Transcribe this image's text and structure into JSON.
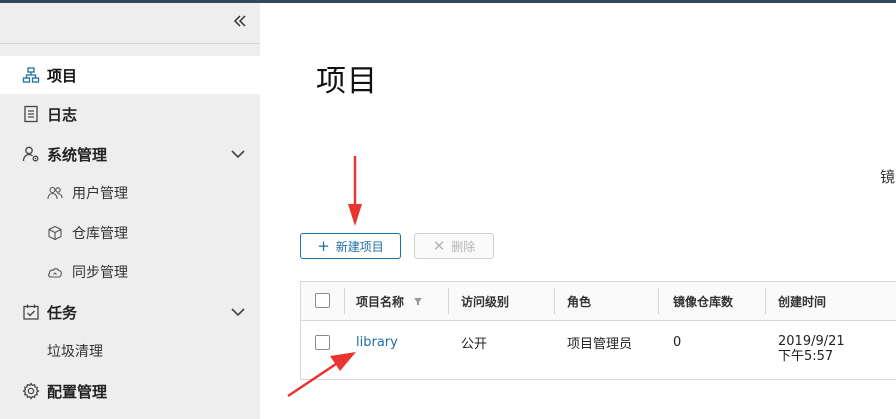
{
  "sidebar": {
    "items": [
      {
        "label": "项目",
        "icon": "project-icon",
        "active": true
      },
      {
        "label": "日志",
        "icon": "log-icon"
      },
      {
        "label": "系统管理",
        "icon": "user-gear-icon"
      },
      {
        "label": "用户管理",
        "icon": "users-icon"
      },
      {
        "label": "仓库管理",
        "icon": "cube-icon"
      },
      {
        "label": "同步管理",
        "icon": "cloud-icon"
      },
      {
        "label": "任务",
        "icon": "calendar-check-icon"
      },
      {
        "label": "垃圾清理"
      },
      {
        "label": "配置管理",
        "icon": "gear-icon"
      }
    ]
  },
  "main": {
    "title": "项目",
    "cut_text": "镜",
    "toolbar": {
      "new_label": "新建项目",
      "delete_label": "删除"
    },
    "table": {
      "columns": [
        "项目名称",
        "访问级别",
        "角色",
        "镜像仓库数",
        "创建时间"
      ],
      "rows": [
        {
          "name": "library",
          "access": "公开",
          "role": "项目管理员",
          "repo_count": "0",
          "created_date": "2019/9/21",
          "created_time": "下午5:57"
        }
      ]
    }
  },
  "colors": {
    "accent": "#1d6fa5",
    "annotation": "#e8352f",
    "sidebar_bg": "#eeeeee"
  }
}
